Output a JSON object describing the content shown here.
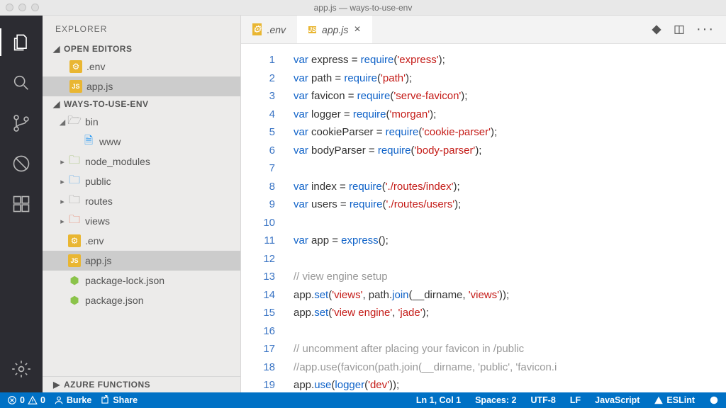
{
  "window": {
    "title": "app.js — ways-to-use-env"
  },
  "activity": {
    "items": [
      {
        "name": "explorer-icon",
        "active": true
      },
      {
        "name": "search-icon",
        "active": false
      },
      {
        "name": "source-control-icon",
        "active": false
      },
      {
        "name": "debug-icon",
        "active": false
      },
      {
        "name": "extensions-icon",
        "active": false
      }
    ],
    "gear": "gear-icon"
  },
  "sidebar": {
    "title": "EXPLORER",
    "sections": {
      "openEditors": {
        "label": "OPEN EDITORS",
        "items": [
          {
            "icon": "env",
            "label": ".env"
          },
          {
            "icon": "jsy",
            "label": "app.js",
            "selected": true
          }
        ]
      },
      "workspace": {
        "label": "WAYS-TO-USE-ENV",
        "items": [
          {
            "kind": "folder-open",
            "depth": 0,
            "label": "bin",
            "iconClass": "icon-folder"
          },
          {
            "kind": "file",
            "depth": 1,
            "label": "www",
            "iconClass": "icon-www"
          },
          {
            "kind": "folder",
            "depth": 0,
            "label": "node_modules",
            "iconClass": "icon-folder-node"
          },
          {
            "kind": "folder",
            "depth": 0,
            "label": "public",
            "iconClass": "icon-folder-public"
          },
          {
            "kind": "folder",
            "depth": 0,
            "label": "routes",
            "iconClass": "icon-folder"
          },
          {
            "kind": "folder",
            "depth": 0,
            "label": "views",
            "iconClass": "icon-folder-views"
          },
          {
            "kind": "file",
            "depth": 0,
            "label": ".env",
            "iconClass": "icon-env",
            "pill": true
          },
          {
            "kind": "file",
            "depth": 0,
            "label": "app.js",
            "iconClass": "icon-jsy",
            "pill": true,
            "selected": true
          },
          {
            "kind": "file",
            "depth": 0,
            "label": "package-lock.json",
            "iconClass": "icon-json"
          },
          {
            "kind": "file",
            "depth": 0,
            "label": "package.json",
            "iconClass": "icon-json"
          }
        ]
      },
      "azure": {
        "label": "AZURE FUNCTIONS"
      }
    }
  },
  "tabs": {
    "items": [
      {
        "icon": "env",
        "label": ".env",
        "active": false,
        "closable": false
      },
      {
        "icon": "jsy",
        "label": "app.js",
        "active": true,
        "closable": true
      }
    ]
  },
  "code": {
    "lines": [
      [
        {
          "t": "var ",
          "c": "kw"
        },
        {
          "t": "express ",
          "c": "id"
        },
        {
          "t": "= ",
          "c": "op"
        },
        {
          "t": "require",
          "c": "fn"
        },
        {
          "t": "(",
          "c": "op"
        },
        {
          "t": "'express'",
          "c": "str"
        },
        {
          "t": ");",
          "c": "op"
        }
      ],
      [
        {
          "t": "var ",
          "c": "kw"
        },
        {
          "t": "path ",
          "c": "id"
        },
        {
          "t": "= ",
          "c": "op"
        },
        {
          "t": "require",
          "c": "fn"
        },
        {
          "t": "(",
          "c": "op"
        },
        {
          "t": "'path'",
          "c": "str"
        },
        {
          "t": ");",
          "c": "op"
        }
      ],
      [
        {
          "t": "var ",
          "c": "kw"
        },
        {
          "t": "favicon ",
          "c": "id"
        },
        {
          "t": "= ",
          "c": "op"
        },
        {
          "t": "require",
          "c": "fn"
        },
        {
          "t": "(",
          "c": "op"
        },
        {
          "t": "'serve-favicon'",
          "c": "str"
        },
        {
          "t": ");",
          "c": "op"
        }
      ],
      [
        {
          "t": "var ",
          "c": "kw"
        },
        {
          "t": "logger ",
          "c": "id"
        },
        {
          "t": "= ",
          "c": "op"
        },
        {
          "t": "require",
          "c": "fn"
        },
        {
          "t": "(",
          "c": "op"
        },
        {
          "t": "'morgan'",
          "c": "str"
        },
        {
          "t": ");",
          "c": "op"
        }
      ],
      [
        {
          "t": "var ",
          "c": "kw"
        },
        {
          "t": "cookieParser ",
          "c": "id"
        },
        {
          "t": "= ",
          "c": "op"
        },
        {
          "t": "require",
          "c": "fn"
        },
        {
          "t": "(",
          "c": "op"
        },
        {
          "t": "'cookie-parser'",
          "c": "str"
        },
        {
          "t": ");",
          "c": "op"
        }
      ],
      [
        {
          "t": "var ",
          "c": "kw"
        },
        {
          "t": "bodyParser ",
          "c": "id"
        },
        {
          "t": "= ",
          "c": "op"
        },
        {
          "t": "require",
          "c": "fn"
        },
        {
          "t": "(",
          "c": "op"
        },
        {
          "t": "'body-parser'",
          "c": "str"
        },
        {
          "t": ");",
          "c": "op"
        }
      ],
      [],
      [
        {
          "t": "var ",
          "c": "kw"
        },
        {
          "t": "index ",
          "c": "id"
        },
        {
          "t": "= ",
          "c": "op"
        },
        {
          "t": "require",
          "c": "fn"
        },
        {
          "t": "(",
          "c": "op"
        },
        {
          "t": "'./routes/index'",
          "c": "str"
        },
        {
          "t": ");",
          "c": "op"
        }
      ],
      [
        {
          "t": "var ",
          "c": "kw"
        },
        {
          "t": "users ",
          "c": "id"
        },
        {
          "t": "= ",
          "c": "op"
        },
        {
          "t": "require",
          "c": "fn"
        },
        {
          "t": "(",
          "c": "op"
        },
        {
          "t": "'./routes/users'",
          "c": "str"
        },
        {
          "t": ");",
          "c": "op"
        }
      ],
      [],
      [
        {
          "t": "var ",
          "c": "kw"
        },
        {
          "t": "app ",
          "c": "id"
        },
        {
          "t": "= ",
          "c": "op"
        },
        {
          "t": "express",
          "c": "fn"
        },
        {
          "t": "();",
          "c": "op"
        }
      ],
      [],
      [
        {
          "t": "// view engine setup",
          "c": "cm"
        }
      ],
      [
        {
          "t": "app.",
          "c": "id"
        },
        {
          "t": "set",
          "c": "fn"
        },
        {
          "t": "(",
          "c": "op"
        },
        {
          "t": "'views'",
          "c": "str"
        },
        {
          "t": ", path.",
          "c": "id"
        },
        {
          "t": "join",
          "c": "fn"
        },
        {
          "t": "(__dirname, ",
          "c": "id"
        },
        {
          "t": "'views'",
          "c": "str"
        },
        {
          "t": "));",
          "c": "op"
        }
      ],
      [
        {
          "t": "app.",
          "c": "id"
        },
        {
          "t": "set",
          "c": "fn"
        },
        {
          "t": "(",
          "c": "op"
        },
        {
          "t": "'view engine'",
          "c": "str"
        },
        {
          "t": ", ",
          "c": "op"
        },
        {
          "t": "'jade'",
          "c": "str"
        },
        {
          "t": ");",
          "c": "op"
        }
      ],
      [],
      [
        {
          "t": "// uncomment after placing your favicon in /public",
          "c": "cm"
        }
      ],
      [
        {
          "t": "//app.use(favicon(path.join(__dirname, 'public', 'favicon.i",
          "c": "cm"
        }
      ],
      [
        {
          "t": "app.",
          "c": "id"
        },
        {
          "t": "use",
          "c": "fn"
        },
        {
          "t": "(",
          "c": "op"
        },
        {
          "t": "logger",
          "c": "fn"
        },
        {
          "t": "(",
          "c": "op"
        },
        {
          "t": "'dev'",
          "c": "str"
        },
        {
          "t": "));",
          "c": "op"
        }
      ]
    ]
  },
  "status": {
    "errors": "0",
    "warnings": "0",
    "user": "Burke",
    "share": "Share",
    "pos": "Ln 1, Col 1",
    "spaces": "Spaces: 2",
    "encoding": "UTF-8",
    "eol": "LF",
    "lang": "JavaScript",
    "lint": "ESLint"
  }
}
